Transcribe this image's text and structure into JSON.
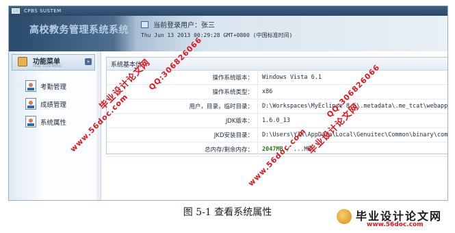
{
  "window": {
    "title": "CPBS SUSTEM"
  },
  "header": {
    "system_title": "高校教务管理系统系统",
    "current_user_label": "当前登录用户：张三",
    "datetime": "Thu Jun 13 2013 00:29:28 GMT+0800 (中国标准时间)"
  },
  "sidebar": {
    "menu_title": "功能菜单",
    "menu_subtitle": "FUNCTION MENU",
    "collapse_symbol": "»",
    "items": [
      {
        "label": "考勤管理",
        "icon": "user-card-icon"
      },
      {
        "label": "成绩管理",
        "icon": "user-card-icon"
      },
      {
        "label": "系统属性",
        "icon": "user-card-icon"
      }
    ]
  },
  "panel": {
    "title": "系统基本信",
    "rows": [
      {
        "label": "操作系统版本：",
        "value": "Windows Vista  6.1"
      },
      {
        "label": "操作系统类型：",
        "value": "x86"
      },
      {
        "label": "用户，目录，临时目录：",
        "value": "D:\\Workspaces\\MyEclipse 8.5\\.metadata\\.me_tcat\\webapps\\jwglxt\\"
      },
      {
        "label": "JDK版本：",
        "value": "1.6.0_13"
      },
      {
        "label": "JKD安装目录：",
        "value": "D:\\Users\\YZK\\AppData\\Local\\Genuitec\\Common\\binary\\com.sun.java..."
      },
      {
        "label": "总内存/剩余内存：",
        "value_total": "2047MB",
        "value_sep": " / ",
        "value_free": "...MB"
      }
    ]
  },
  "caption": "图 5-1  查看系统属性",
  "watermarks": {
    "site_text": "毕业设计论文网",
    "qq_text": "QQ:306826066",
    "url_text": "www.56doc.com"
  },
  "colors": {
    "header_dark": "#2a4a6b",
    "watermark_red": "#e0141c",
    "memory_green": "#2a7a1a"
  }
}
